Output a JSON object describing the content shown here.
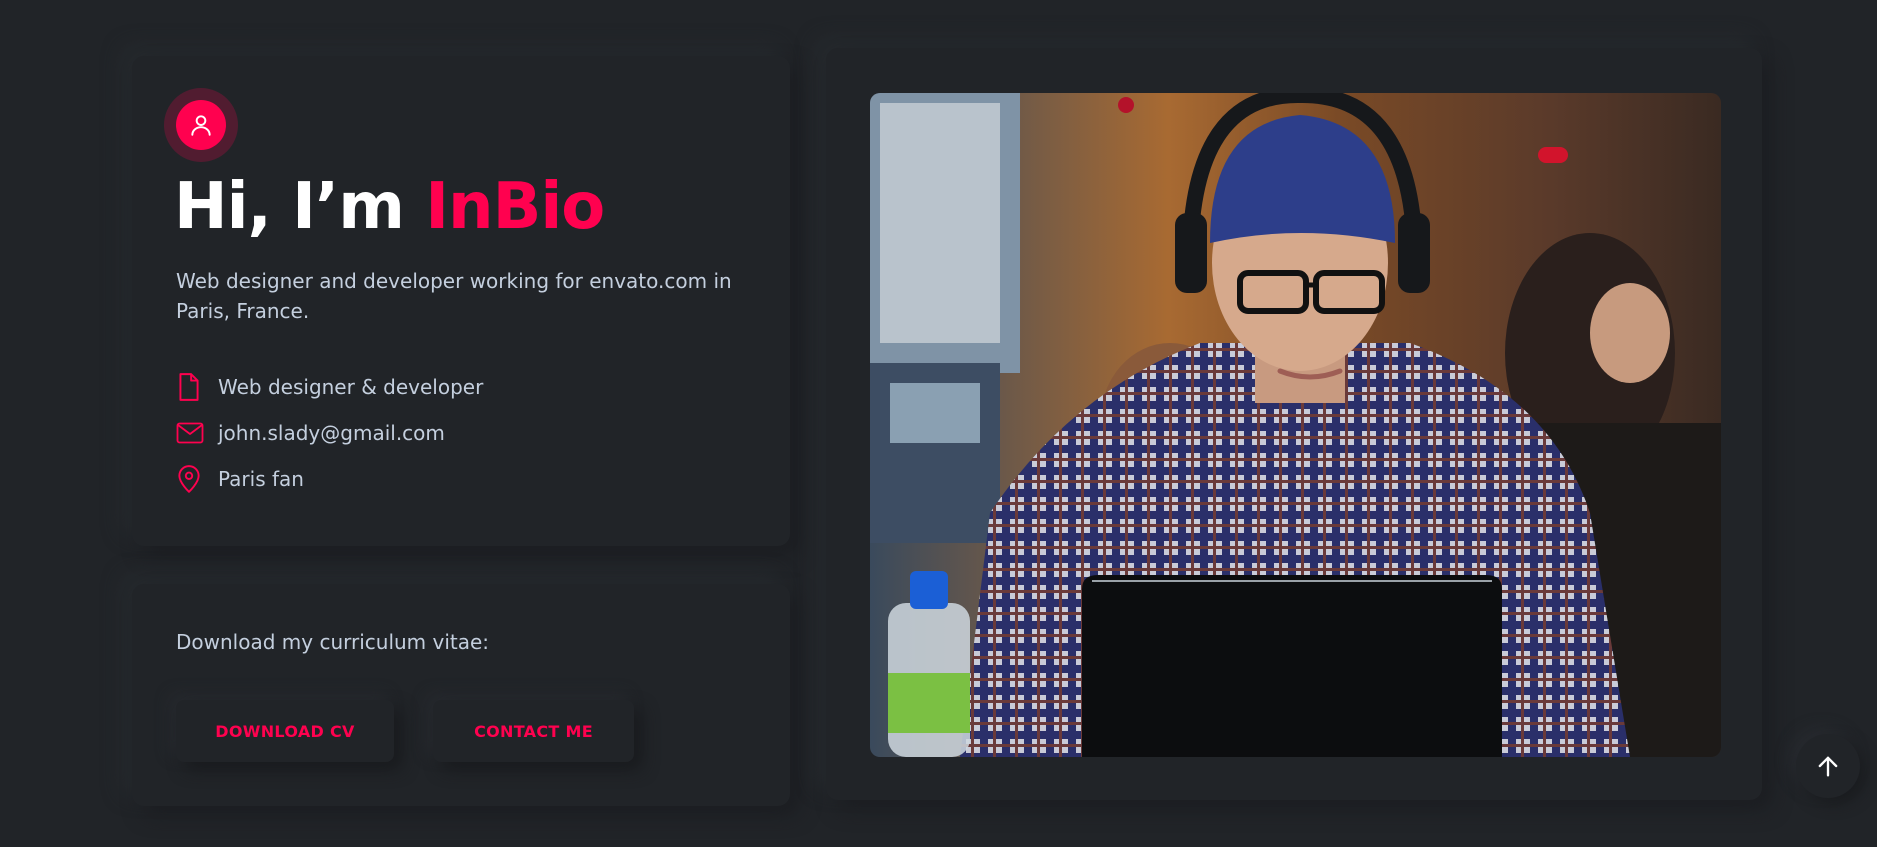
{
  "colors": {
    "background": "#212428",
    "accent": "#ff014f",
    "text": "#c4cfde",
    "heading": "#ffffff"
  },
  "intro": {
    "avatar_icon": "user-icon",
    "headline_prefix": "Hi, I’m ",
    "headline_name": "InBio",
    "description": "Web designer and developer working for envato.com in Paris, France.",
    "info": [
      {
        "icon": "file-icon",
        "text": "Web designer & developer"
      },
      {
        "icon": "mail-icon",
        "text": "john.slady@gmail.com"
      },
      {
        "icon": "map-pin-icon",
        "text": "Paris fan"
      }
    ]
  },
  "cv": {
    "label": "Download my curriculum vitae:",
    "download_button": "DOWNLOAD CV",
    "contact_button": "CONTACT ME"
  },
  "photo": {
    "alt": "photo"
  },
  "scroll_top": {
    "icon": "arrow-up-icon"
  }
}
